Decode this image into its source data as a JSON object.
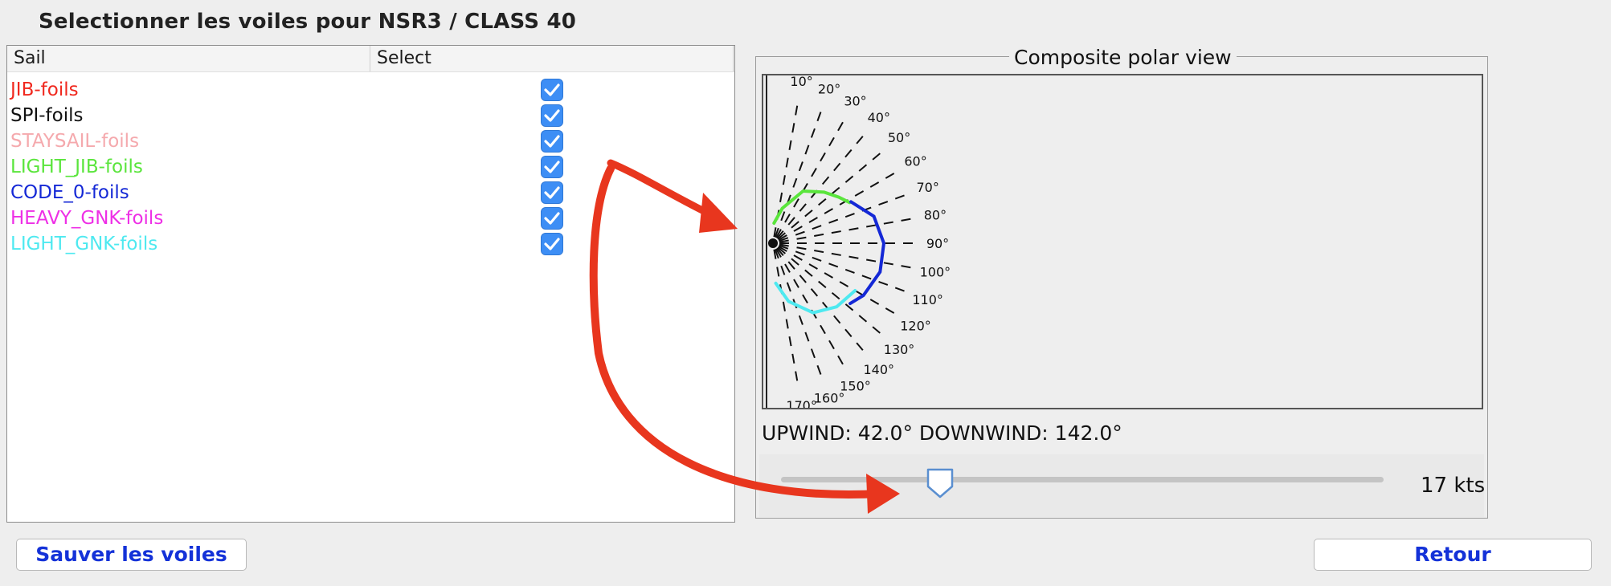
{
  "title": "Selectionner les voiles pour NSR3 / CLASS 40",
  "table": {
    "columns": [
      "Sail",
      "Select"
    ],
    "rows": [
      {
        "name": "JIB-foils",
        "color": "#f0281e",
        "selected": true
      },
      {
        "name": "SPI-foils",
        "color": "#111111",
        "selected": true
      },
      {
        "name": "STAYSAIL-foils",
        "color": "#f5a9ad",
        "selected": true
      },
      {
        "name": "LIGHT_JIB-foils",
        "color": "#5ae53c",
        "selected": true
      },
      {
        "name": "CODE_0-foils",
        "color": "#1428d6",
        "selected": true
      },
      {
        "name": "HEAVY_GNK-foils",
        "color": "#ee2fe6",
        "selected": true
      },
      {
        "name": "LIGHT_GNK-foils",
        "color": "#4ee9f0",
        "selected": true
      }
    ]
  },
  "polar": {
    "legend": "Composite polar view",
    "angle_labels": [
      "10°",
      "20°",
      "30°",
      "40°",
      "50°",
      "60°",
      "70°",
      "80°",
      "90°",
      "100°",
      "110°",
      "120°",
      "130°",
      "140°",
      "150°",
      "160°",
      "170°"
    ],
    "curve_colors": {
      "light_jib": "#5ae53c",
      "code_0": "#1428d6",
      "light_gnk": "#4ee9f0"
    }
  },
  "winds": "UPWIND: 42.0° DOWNWIND: 142.0°",
  "slider": {
    "value_label": "17 kts",
    "fraction": 0.25
  },
  "buttons": {
    "save": "Sauver les voiles",
    "back": "Retour"
  },
  "annotation_color": "#e8361e"
}
